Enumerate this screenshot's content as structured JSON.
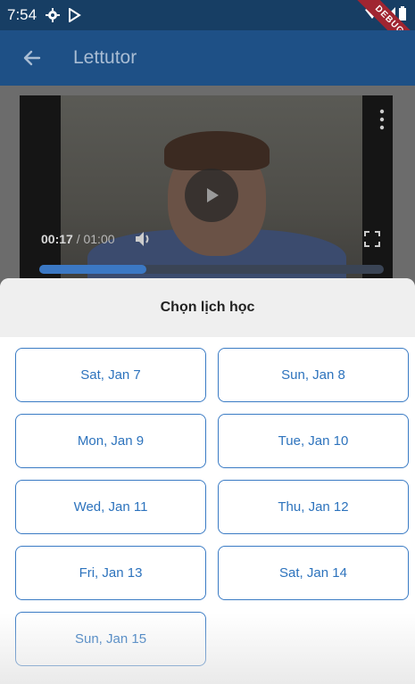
{
  "status_bar": {
    "time": "7:54",
    "icons_left": [
      "gear-icon",
      "play-store-icon"
    ],
    "icons_right": [
      "wifi-icon",
      "signal-icon",
      "battery-icon"
    ],
    "debug_banner": "DEBUG"
  },
  "app_bar": {
    "title": "Lettutor",
    "back_icon": "arrow-back-icon"
  },
  "video": {
    "current_time": "00:17",
    "duration": "/ 01:00",
    "progress": 0.31,
    "colors": {
      "progress": "#3b78c4",
      "track": "#3a4455"
    }
  },
  "sheet": {
    "title": "Chọn lịch học",
    "dates": [
      "Sat, Jan 7",
      "Sun, Jan 8",
      "Mon, Jan 9",
      "Tue, Jan 10",
      "Wed, Jan 11",
      "Thu, Jan 12",
      "Fri, Jan 13",
      "Sat, Jan 14",
      "Sun, Jan 15"
    ]
  },
  "colors": {
    "app_bar": "#1e5086",
    "status_bar": "#173e64",
    "accent": "#2d73bd",
    "debug": "#a02531"
  }
}
